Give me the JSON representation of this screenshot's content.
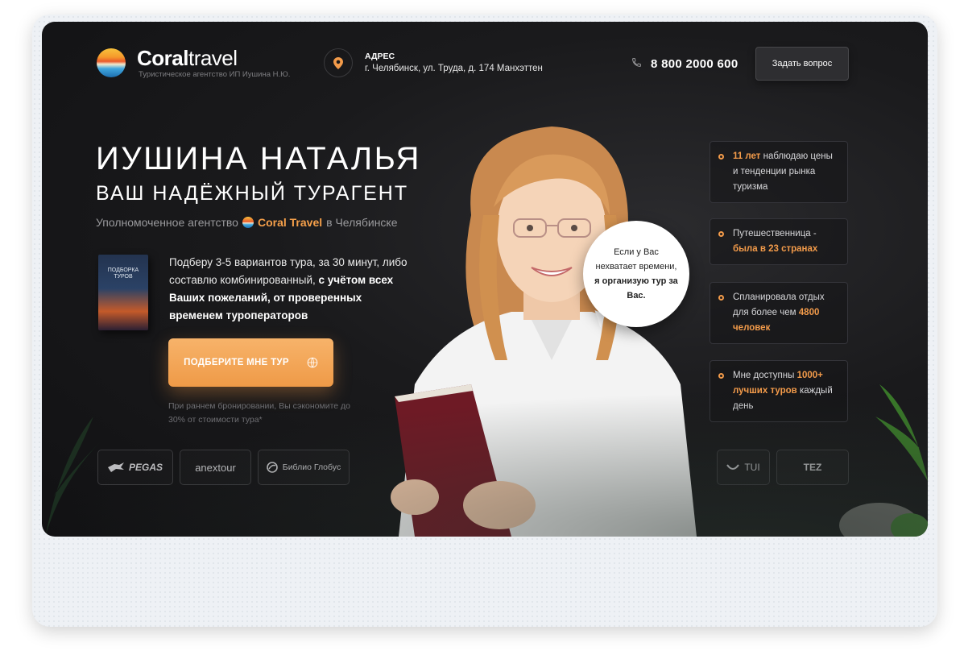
{
  "brand": {
    "logo_bold": "Coral",
    "logo_light": "travel",
    "subtitle": "Туристическое агентство ИП Иушина Н.Ю."
  },
  "header": {
    "address_label": "АДРЕС",
    "address": "г. Челябинск, ул. Труда, д. 174 Манхэттен",
    "phone": "8 800 2000 600",
    "ask_button": "Задать вопрос"
  },
  "hero": {
    "title": "ИУШИНА НАТАЛЬЯ",
    "subtitle": "ВАШ НАДЁЖНЫЙ ТУРАГЕНТ",
    "agency_prefix": "Уполномоченное агентство",
    "agency_brand": "Coral Travel",
    "agency_suffix": "в Челябинске",
    "book_title": "ПОДБОРКА ТУРОВ",
    "offer_plain": "Подберу 3-5 вариантов тура, за 30 минут, либо составлю комбинированный,",
    "offer_bold": "с учётом всех Ваших пожеланий, от проверенных временем туроператоров",
    "cta": "ПОДБЕРИТЕ МНЕ ТУР",
    "note": "При раннем бронировании, Вы сэкономите до 30% от стоимости тура*"
  },
  "bubble": {
    "plain": "Если у Вас нехватает времени,",
    "bold": "я организую тур за Вас."
  },
  "stats": [
    {
      "hl": "11 лет",
      "text_after": "наблюдаю цены и тенденции рынка туризма",
      "text_before": ""
    },
    {
      "text_before": "Путешественница -",
      "hl": "была в 23 странах",
      "text_after": ""
    },
    {
      "text_before": "Спланировала отдых для более чем",
      "hl": "4800 человек",
      "text_after": ""
    },
    {
      "text_before": "Мне доступны",
      "hl": "1000+ лучших туров",
      "text_after": "каждый день"
    }
  ],
  "partners": [
    "PEGAS",
    "anextour",
    "Библио Глобус",
    "TUI",
    "TEZ"
  ],
  "colors": {
    "accent": "#f39b4a",
    "background": "#1a1a1c",
    "cta": "#ef9a47"
  }
}
